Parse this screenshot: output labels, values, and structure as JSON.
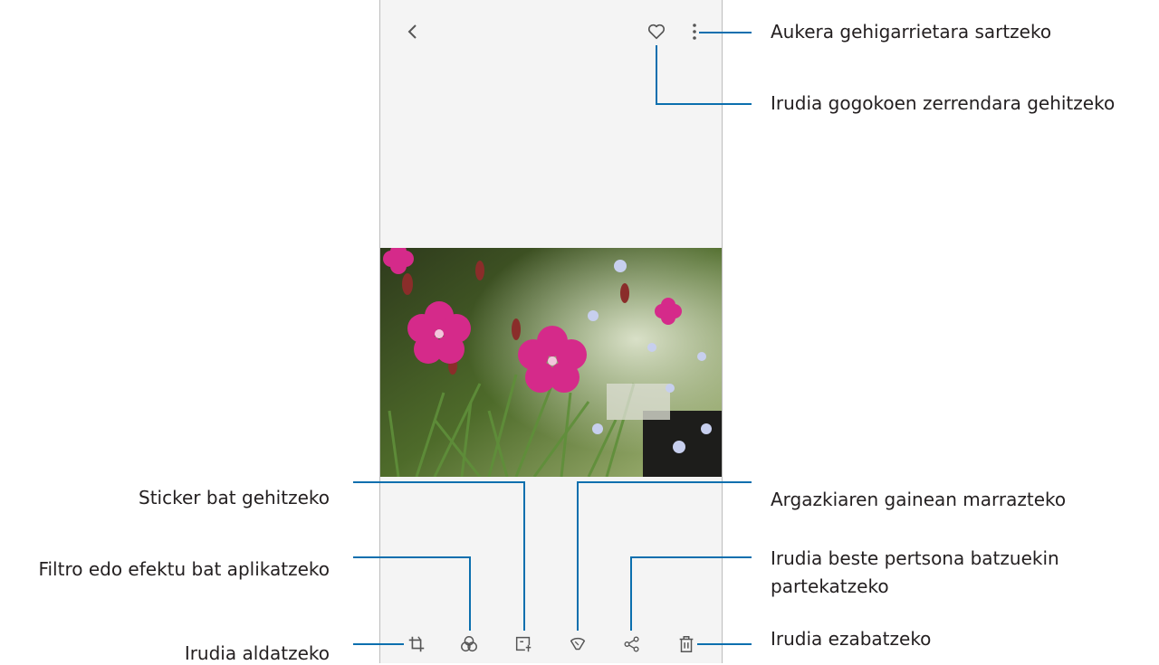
{
  "callouts": {
    "more_options": "Aukera gehigarrietara sartzeko",
    "favourite": "Irudia gogokoen zerrendara gehitzeko",
    "sticker": "Sticker bat gehitzeko",
    "draw": "Argazkiaren gainean marrazteko",
    "filter": "Filtro edo efektu bat aplikatzeko",
    "share_line1": "Irudia beste pertsona batzuekin",
    "share_line2": "partekatzeko",
    "edit": "Irudia aldatzeko",
    "delete": "Irudia ezabatzeko"
  },
  "icons": {
    "top": [
      "back-icon",
      "heart-icon",
      "more-options-icon"
    ],
    "bottom": [
      "crop-edit-icon",
      "filter-icon",
      "sticker-icon",
      "draw-icon",
      "share-icon",
      "delete-icon"
    ]
  },
  "colors": {
    "callout_line": "#0b6fae",
    "screen_background": "#f4f4f4",
    "text": "#231f20"
  }
}
